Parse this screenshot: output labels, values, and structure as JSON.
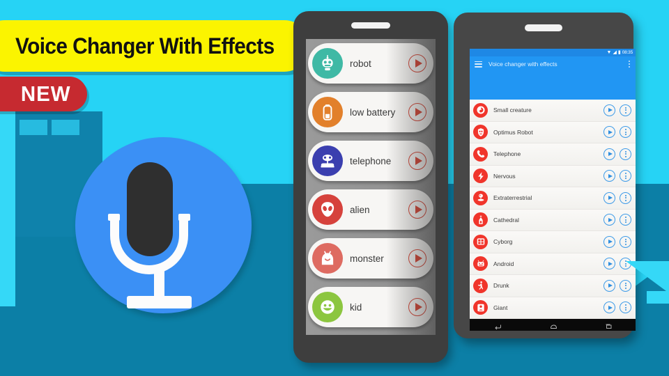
{
  "banner": {
    "title": "Voice Changer With Effects",
    "new_badge": "NEW",
    "colors": {
      "title_pill": "#FBF400",
      "new_badge": "#C62A30",
      "background_cyan": "#26D3F5",
      "background_teal": "#0C7FA6",
      "logo_circle": "#3B90F5"
    },
    "logo_icon": "microphone-icon"
  },
  "phone_left": {
    "device": "tablet-frame-dark",
    "effects": [
      {
        "label": "robot",
        "icon": "robot-icon",
        "color": "#3FB9A5"
      },
      {
        "label": "low battery",
        "icon": "battery-icon",
        "color": "#E2802B"
      },
      {
        "label": "telephone",
        "icon": "telephone-icon",
        "color": "#3B3FAF"
      },
      {
        "label": "alien",
        "icon": "alien-icon",
        "color": "#D6423C"
      },
      {
        "label": "monster",
        "icon": "monster-icon",
        "color": "#DE6B61"
      },
      {
        "label": "kid",
        "icon": "kid-icon",
        "color": "#8CC63F"
      }
    ],
    "play_button_label": "play"
  },
  "phone_right": {
    "statusbar": {
      "time": "08:35",
      "icons": [
        "wifi-icon",
        "signal-icon",
        "battery-icon"
      ]
    },
    "appbar": {
      "menu_icon": "hamburger-menu-icon",
      "title": "Voice changer with effects",
      "overflow_icon": "kebab-menu-icon",
      "color": "#2196F3"
    },
    "effects": [
      {
        "label": "Small creature",
        "icon": "small-creature-icon"
      },
      {
        "label": "Optimus Robot",
        "icon": "optimus-robot-icon"
      },
      {
        "label": "Telephone",
        "icon": "telephone-icon"
      },
      {
        "label": "Nervous",
        "icon": "nervous-bolt-icon"
      },
      {
        "label": "Extraterrestrial",
        "icon": "extraterrestrial-icon"
      },
      {
        "label": "Cathedral",
        "icon": "cathedral-icon"
      },
      {
        "label": "Cyborg",
        "icon": "cyborg-icon"
      },
      {
        "label": "Android",
        "icon": "android-icon"
      },
      {
        "label": "Drunk",
        "icon": "drunk-icon"
      },
      {
        "label": "Giant",
        "icon": "giant-icon"
      }
    ],
    "row_actions": {
      "play_label": "play",
      "more_label": "more options"
    },
    "navbar": {
      "back": "back-icon",
      "home": "home-icon",
      "recents": "recents-icon"
    },
    "accent_color": "#F0352B"
  }
}
